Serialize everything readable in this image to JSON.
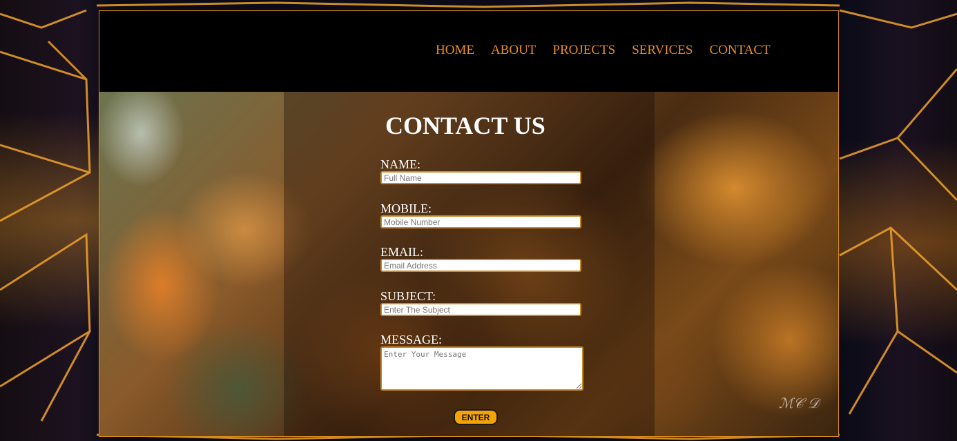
{
  "nav": {
    "items": [
      {
        "label": "HOME"
      },
      {
        "label": "ABOUT"
      },
      {
        "label": "PROJECTS"
      },
      {
        "label": "SERVICES"
      },
      {
        "label": "CONTACT"
      }
    ]
  },
  "contact": {
    "title": "CONTACT US",
    "name_label": "NAME:",
    "name_placeholder": "Full Name",
    "mobile_label": "MOBILE:",
    "mobile_placeholder": "Mobile Number",
    "email_label": "EMAIL:",
    "email_placeholder": "Email Address",
    "subject_label": "SUBJECT:",
    "subject_placeholder": "Enter The Subject",
    "message_label": "MESSAGE:",
    "message_placeholder": "Enter Your Message",
    "submit_label": "ENTER"
  },
  "theme": {
    "accent": "#e98d1f",
    "button_bg": "#f5a300",
    "navbar_bg": "#000000"
  }
}
